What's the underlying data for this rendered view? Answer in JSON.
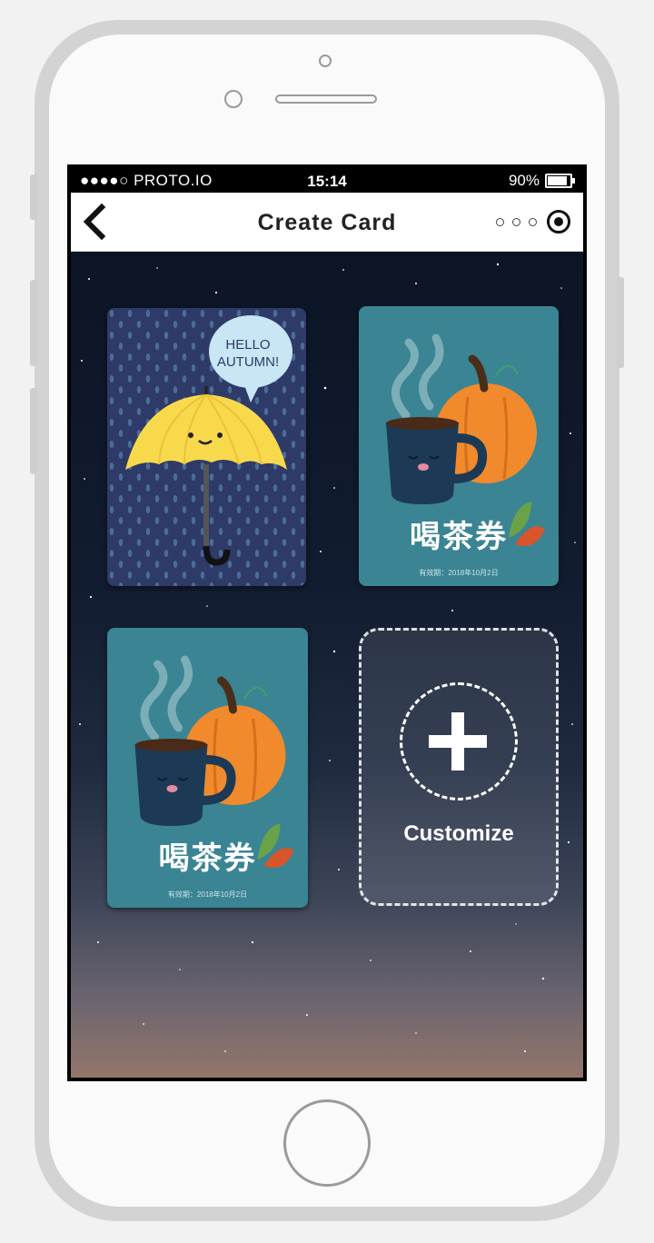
{
  "status_bar": {
    "carrier": "●●●●○ PROTO.IO",
    "time": "15:14",
    "battery": "90%"
  },
  "nav": {
    "title": "Create Card"
  },
  "cards": {
    "autumn": {
      "speech_line1": "HELLO",
      "speech_line2": "AUTUMN!"
    },
    "tea1": {
      "title": "喝茶券",
      "valid": "有效期：2018年10月2日"
    },
    "tea2": {
      "title": "喝茶券",
      "valid": "有效期：2018年10月2日"
    },
    "custom": {
      "label": "Customize"
    }
  },
  "colors": {
    "umbrella": "#f9d94c",
    "pumpkin": "#f08a2c",
    "mug": "#1c3a56",
    "tea_card_bg": "#3a8494",
    "autumn_card_bg": "#2e3a68"
  }
}
